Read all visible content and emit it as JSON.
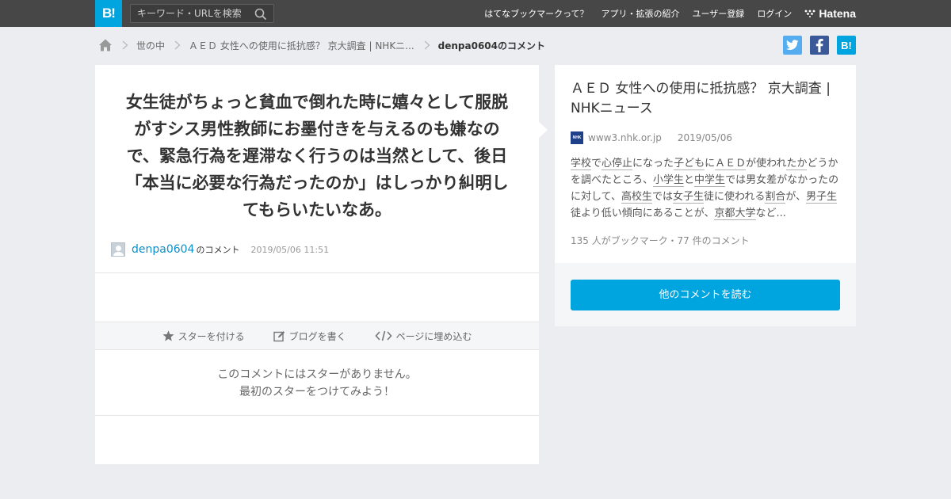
{
  "header": {
    "logo_text": "B!",
    "search_placeholder": "キーワード・URLを検索",
    "nav": [
      "はてなブックマークって？",
      "アプリ・拡張の紹介",
      "ユーザー登録",
      "ログイン"
    ],
    "brand": "Hatena"
  },
  "breadcrumb": {
    "items": [
      "世の中",
      "ＡＥＤ 女性への使用に抵抗感？ 京大調査 | NHKニ..."
    ],
    "current": "denpa0604のコメント"
  },
  "share": {
    "twitter": "t",
    "facebook": "f",
    "hatena": "B!"
  },
  "comment": {
    "text": "女生徒がちょっと貧血で倒れた時に嬉々として服脱がすシス男性教師にお墨付きを与えるのも嫌なので、緊急行為を遅滞なく行うのは当然として、後日「本当に必要な行為だったのか」はしっかり糾明してもらいたいなあ。",
    "username": "denpa0604",
    "username_suffix": "のコメント",
    "datetime": "2019/05/06 11:51"
  },
  "actions": {
    "star": "スターを付ける",
    "blog": "ブログを書く",
    "embed": "ページに埋め込む"
  },
  "no_star": {
    "line1": "このコメントにはスターがありません。",
    "line2": "最初のスターをつけてみよう！"
  },
  "article": {
    "title": "ＡＥＤ 女性への使用に抵抗感？ 京大調査 | NHKニュース",
    "favicon_text": "NHK",
    "domain": "www3.nhk.or.jp",
    "date": "2019/05/06",
    "summary": [
      {
        "t": "学校",
        "u": true
      },
      {
        "t": "で",
        "u": false
      },
      {
        "t": "心停止",
        "u": true
      },
      {
        "t": "になった",
        "u": false
      },
      {
        "t": "子ども",
        "u": true
      },
      {
        "t": "に",
        "u": false
      },
      {
        "t": "ＡＥＤ",
        "u": true
      },
      {
        "t": "が使われ",
        "u": false
      },
      {
        "t": "たか",
        "u": true
      },
      {
        "t": "どうかを調べたところ、",
        "u": false
      },
      {
        "t": "小学生",
        "u": true
      },
      {
        "t": "と",
        "u": false
      },
      {
        "t": "中学生",
        "u": true
      },
      {
        "t": "では男女差がなかったのに対して、",
        "u": false
      },
      {
        "t": "高校生",
        "u": true
      },
      {
        "t": "では",
        "u": false
      },
      {
        "t": "女子生",
        "u": true
      },
      {
        "t": "徒に使われる",
        "u": false
      },
      {
        "t": "割合",
        "u": true
      },
      {
        "t": "が、",
        "u": false
      },
      {
        "t": "男子生",
        "u": true
      },
      {
        "t": "徒より低い傾向にあることが、",
        "u": false
      },
      {
        "t": "京都大学",
        "u": true
      },
      {
        "t": "など...",
        "u": false
      }
    ],
    "stats": "135 人がブックマーク・77 件のコメント"
  },
  "readmore": "他のコメントを読む",
  "colors": {
    "accent": "#00a4de",
    "topbar": "#474747",
    "link": "#0e8fcb"
  }
}
